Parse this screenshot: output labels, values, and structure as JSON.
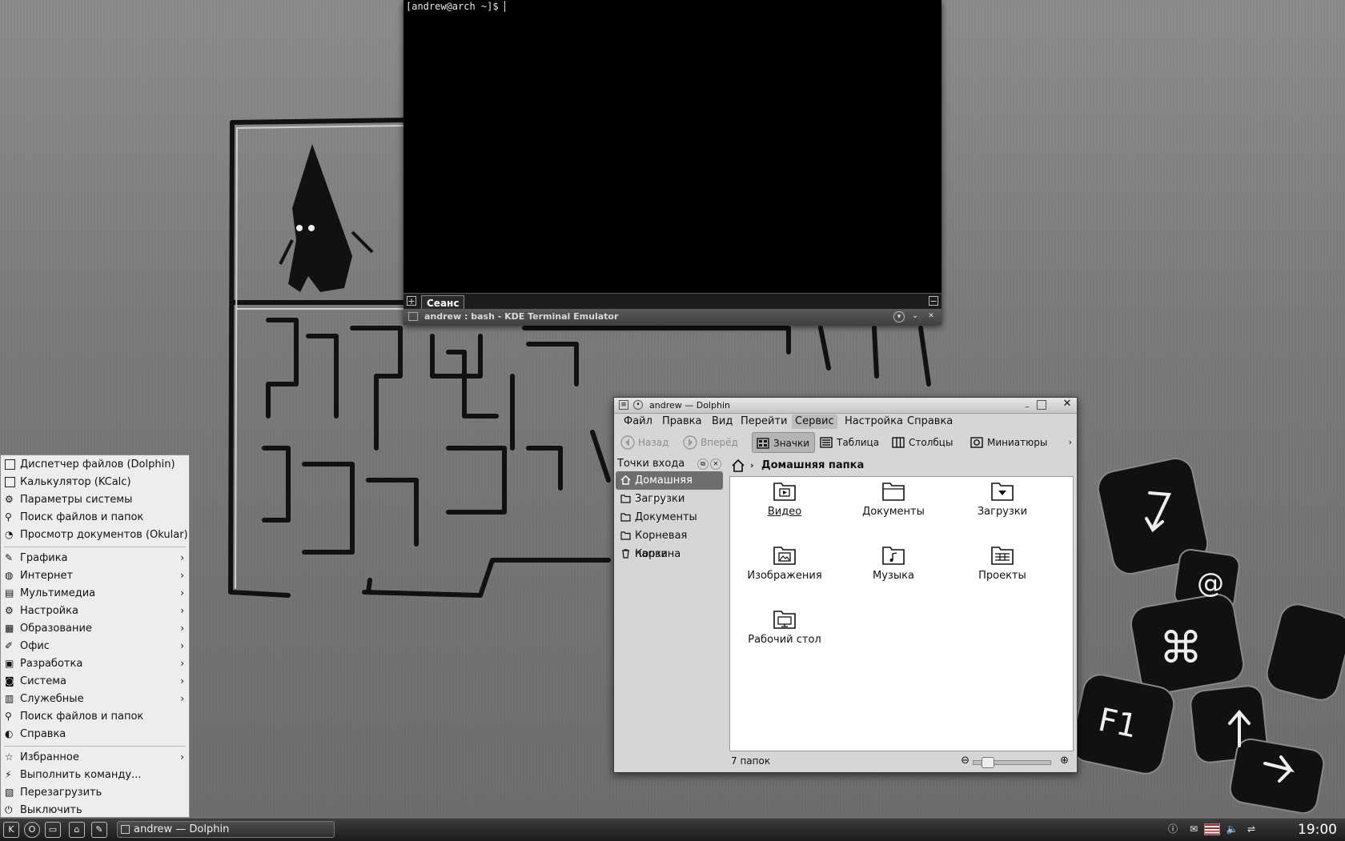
{
  "terminal": {
    "prompt": "[andrew@arch ~]$ ",
    "tab_label": "Сеанс",
    "window_title": "andrew : bash - KDE Terminal Emulator"
  },
  "dolphin": {
    "title": "andrew — Dolphin",
    "menu": [
      "Файл",
      "Правка",
      "Вид",
      "Перейти",
      "Сервис",
      "Настройка",
      "Справка"
    ],
    "active_menu": "Сервис",
    "toolbar": {
      "back": "Назад",
      "forward": "Вперёд",
      "icons": "Значки",
      "details": "Таблица",
      "columns": "Столбцы",
      "preview": "Миниатюры"
    },
    "places_title": "Точки входа",
    "places": [
      "Домашняя папка",
      "Загрузки",
      "Документы",
      "Корневая папка",
      "Корзина"
    ],
    "breadcrumb": "Домашняя папка",
    "files": [
      "Видео",
      "Документы",
      "Загрузки",
      "Изображения",
      "Музыка",
      "Проекты",
      "Рабочий стол"
    ],
    "status": "7 папок"
  },
  "app_menu": {
    "apps": [
      "Диспетчер файлов (Dolphin)",
      "Калькулятор (KCalc)",
      "Параметры системы",
      "Поиск файлов и папок",
      "Просмотр документов (Okular)"
    ],
    "categories": [
      "Графика",
      "Интернет",
      "Мультимедиа",
      "Настройка",
      "Образование",
      "Офис",
      "Разработка",
      "Система",
      "Служебные"
    ],
    "tools": [
      "Поиск файлов и папок",
      "Справка"
    ],
    "session": [
      "Избранное",
      "Выполнить команду...",
      "Перезагрузить",
      "Выключить"
    ]
  },
  "taskbar": {
    "task_label": "andrew — Dolphin",
    "clock": "19:00"
  },
  "colors": {
    "terminal_bg": "#000000",
    "menu_bg": "#ededed",
    "selection": "#6e6e6e"
  }
}
